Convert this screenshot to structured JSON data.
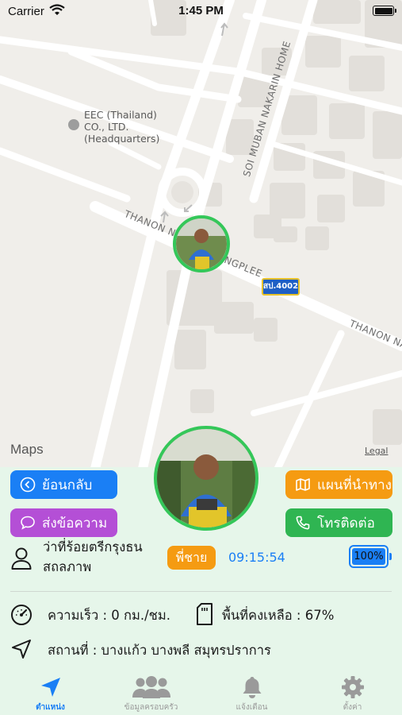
{
  "status_bar": {
    "carrier": "Carrier",
    "time": "1:45 PM"
  },
  "map": {
    "poi_label": [
      "EEC (Thailand)",
      "CO., LTD.",
      "(Headquarters)"
    ],
    "road_labels": {
      "soi_muban": "SOI MUBAN NAKARIN HOME",
      "thanon_na_left": "THANON NA",
      "bangplee": "NGPLEE",
      "thanon_na_right": "THANON NAR"
    },
    "route_shield": "สป.4002",
    "brand": "Maps",
    "legal": "Legal"
  },
  "buttons": {
    "back": "ย้อนกลับ",
    "message": "ส่งข้อความ",
    "route": "แผนที่นำทาง",
    "call": "โทรติดต่อ"
  },
  "member": {
    "name_line1": "ว่าที่ร้อยตรีกรุงธน",
    "name_line2": "สถลภาพ",
    "relation": "พี่ชาย",
    "last_update": "09:15:54",
    "battery": "100%",
    "battery_level": 1.0
  },
  "stats": {
    "speed": "ความเร็ว : 0 กม./ชม.",
    "storage": "พื้นที่คงเหลือ : 67%",
    "location": "สถานที่ : บางแก้ว บางพลี สมุทรปราการ"
  },
  "tabs": [
    {
      "label": "ตำแหน่ง",
      "icon": "location-arrow-icon",
      "active": true
    },
    {
      "label": "ข้อมูลครอบครัว",
      "icon": "family-group-icon",
      "active": false
    },
    {
      "label": "แจ้งเตือน",
      "icon": "bell-icon",
      "active": false
    },
    {
      "label": "ตั้งค่า",
      "icon": "gear-icon",
      "active": false
    }
  ],
  "colors": {
    "primary_blue": "#1a7ff5",
    "purple": "#b44fd6",
    "orange": "#f59b12",
    "green": "#2fb552",
    "avatar_ring": "#34c759",
    "panel_bg": "#e6f6ea"
  }
}
